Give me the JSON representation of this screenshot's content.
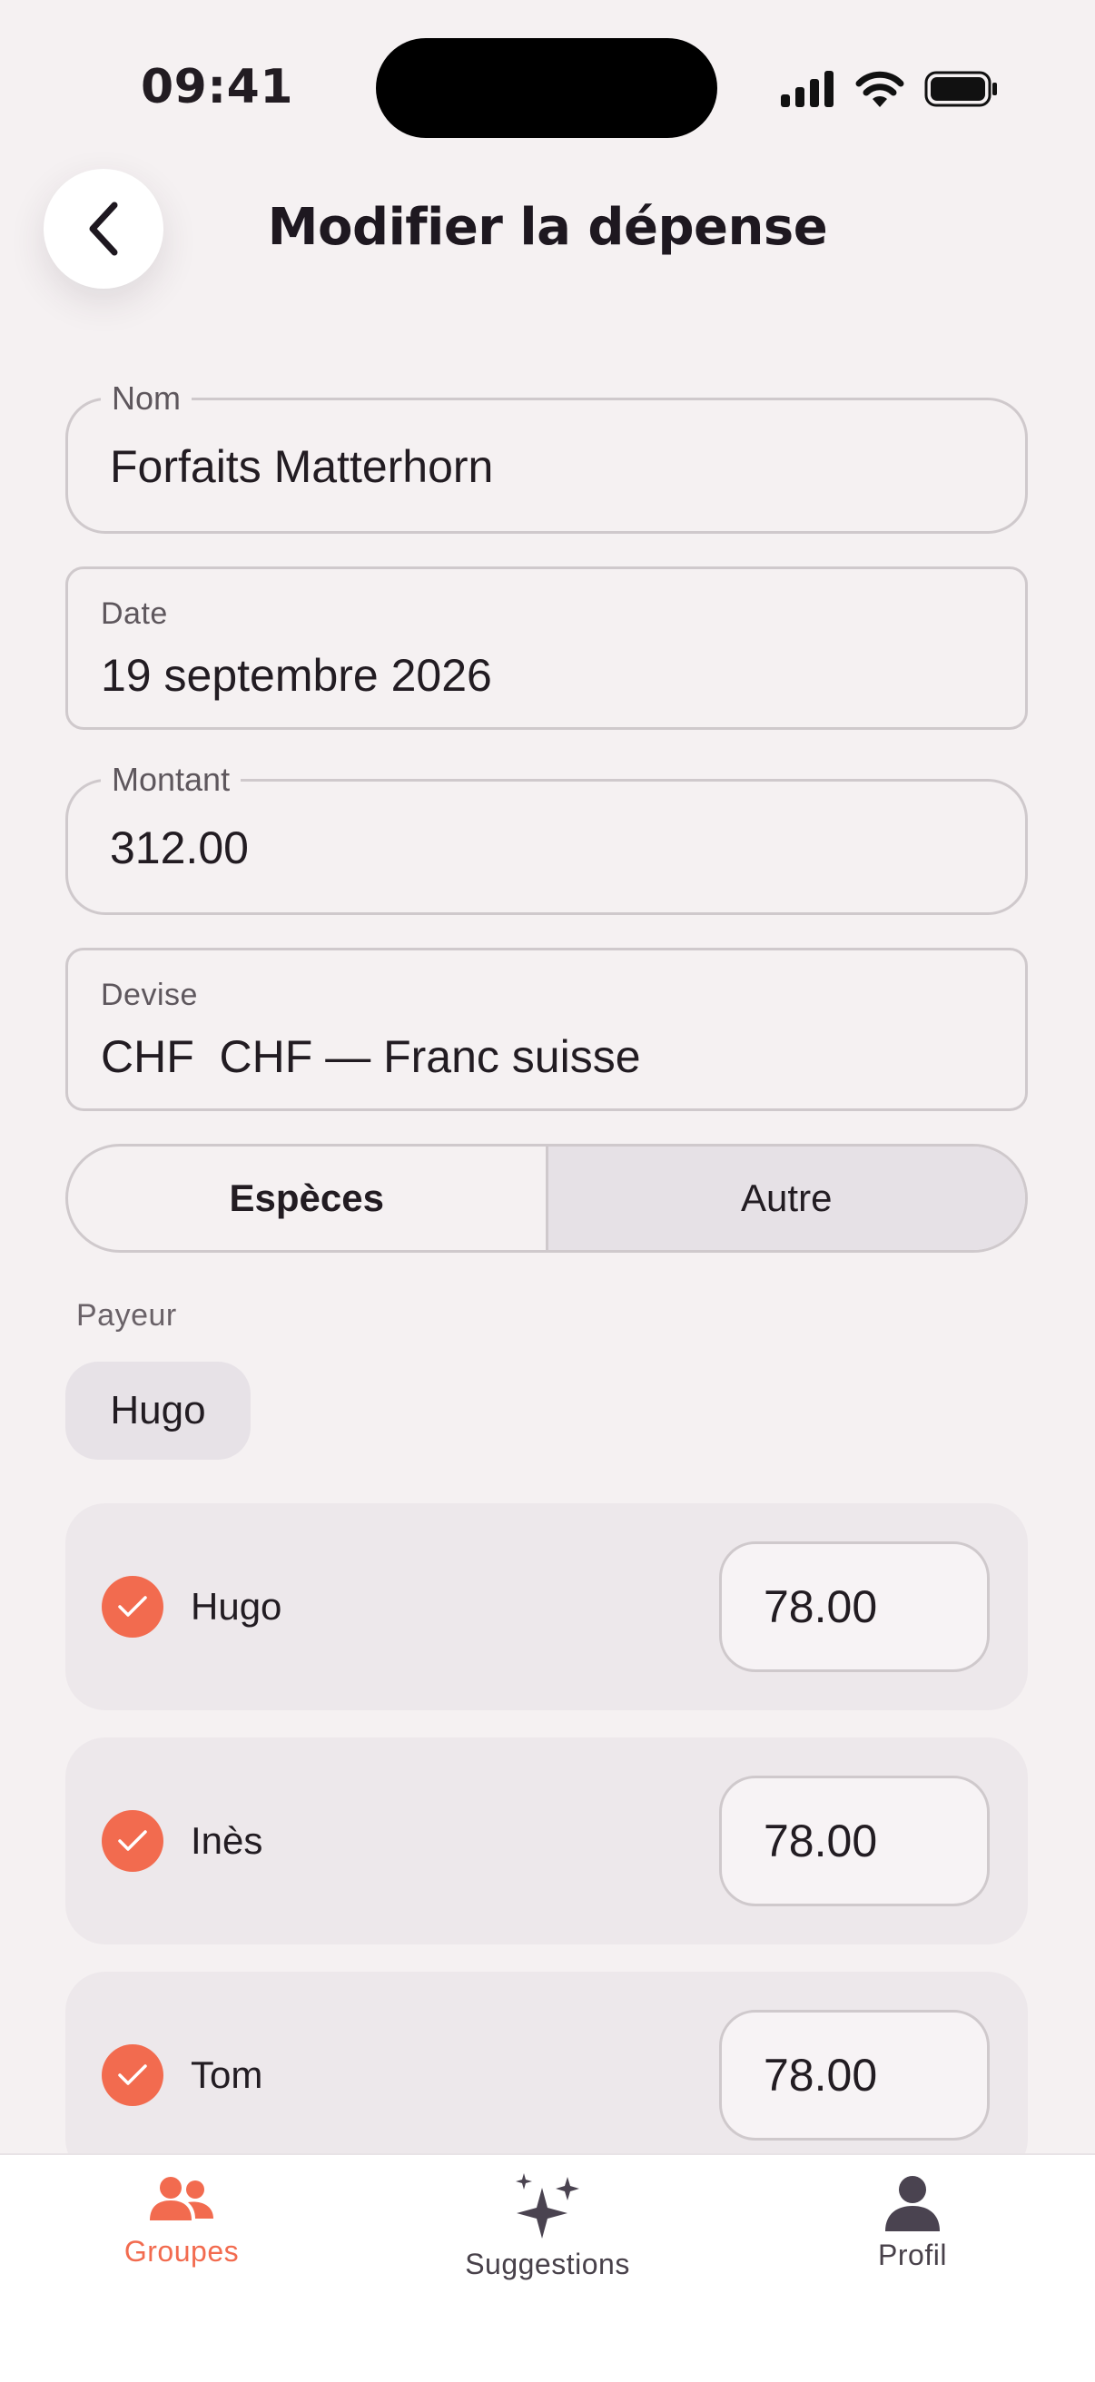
{
  "status_bar": {
    "time": "09:41"
  },
  "header": {
    "title": "Modifier la dépense"
  },
  "form": {
    "name": {
      "label": "Nom",
      "value": "Forfaits Matterhorn"
    },
    "date": {
      "label": "Date",
      "value": "19 septembre 2026"
    },
    "amount": {
      "label": "Montant",
      "value": "312.00"
    },
    "currency": {
      "label": "Devise",
      "value": "CHF  CHF — Franc suisse"
    },
    "payment_method": {
      "options": [
        "Espèces",
        "Autre"
      ],
      "selected": "Autre"
    },
    "payer": {
      "label": "Payeur",
      "value": "Hugo"
    },
    "participants": [
      {
        "name": "Hugo",
        "checked": true,
        "amount": "78.00"
      },
      {
        "name": "Inès",
        "checked": true,
        "amount": "78.00"
      },
      {
        "name": "Tom",
        "checked": true,
        "amount": "78.00"
      }
    ]
  },
  "tabbar": {
    "items": [
      {
        "label": "Groupes",
        "icon": "groups-icon",
        "active": true
      },
      {
        "label": "Suggestions",
        "icon": "sparkles-icon",
        "active": false
      },
      {
        "label": "Profil",
        "icon": "profile-icon",
        "active": false
      }
    ]
  },
  "colors": {
    "accent": "#f26b4f",
    "background": "#f5f1f2",
    "card": "#ede8eb"
  }
}
